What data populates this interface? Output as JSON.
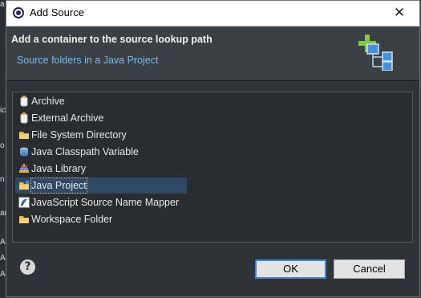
{
  "background_window": {
    "fragments": [
      "a",
      "ic",
      "o",
      "n",
      "ar",
      "A",
      "A",
      "A"
    ]
  },
  "dialog": {
    "title": "Add Source",
    "close_glyph": "✕",
    "header": {
      "title": "Add a container to the source lookup path",
      "description": "Source folders in a Java Project"
    },
    "items": [
      {
        "label": "Archive",
        "icon": "archive-icon",
        "selected": false
      },
      {
        "label": "External Archive",
        "icon": "external-archive-icon",
        "selected": false
      },
      {
        "label": "File System Directory",
        "icon": "folder-icon",
        "selected": false
      },
      {
        "label": "Java Classpath Variable",
        "icon": "classpath-variable-icon",
        "selected": false
      },
      {
        "label": "Java Library",
        "icon": "library-icon",
        "selected": false
      },
      {
        "label": "Java Project",
        "icon": "project-folder-icon",
        "selected": true
      },
      {
        "label": "JavaScript Source Name Mapper",
        "icon": "mapper-icon",
        "selected": false
      },
      {
        "label": "Workspace Folder",
        "icon": "workspace-folder-icon",
        "selected": false
      }
    ],
    "help_glyph": "?",
    "buttons": {
      "ok": "OK",
      "cancel": "Cancel"
    }
  },
  "colors": {
    "dialog_bg": "#2f3337",
    "header_bg": "#3b4045",
    "description": "#79b8e8",
    "selection": "#2f4863",
    "ok_border": "#3a86d4"
  }
}
